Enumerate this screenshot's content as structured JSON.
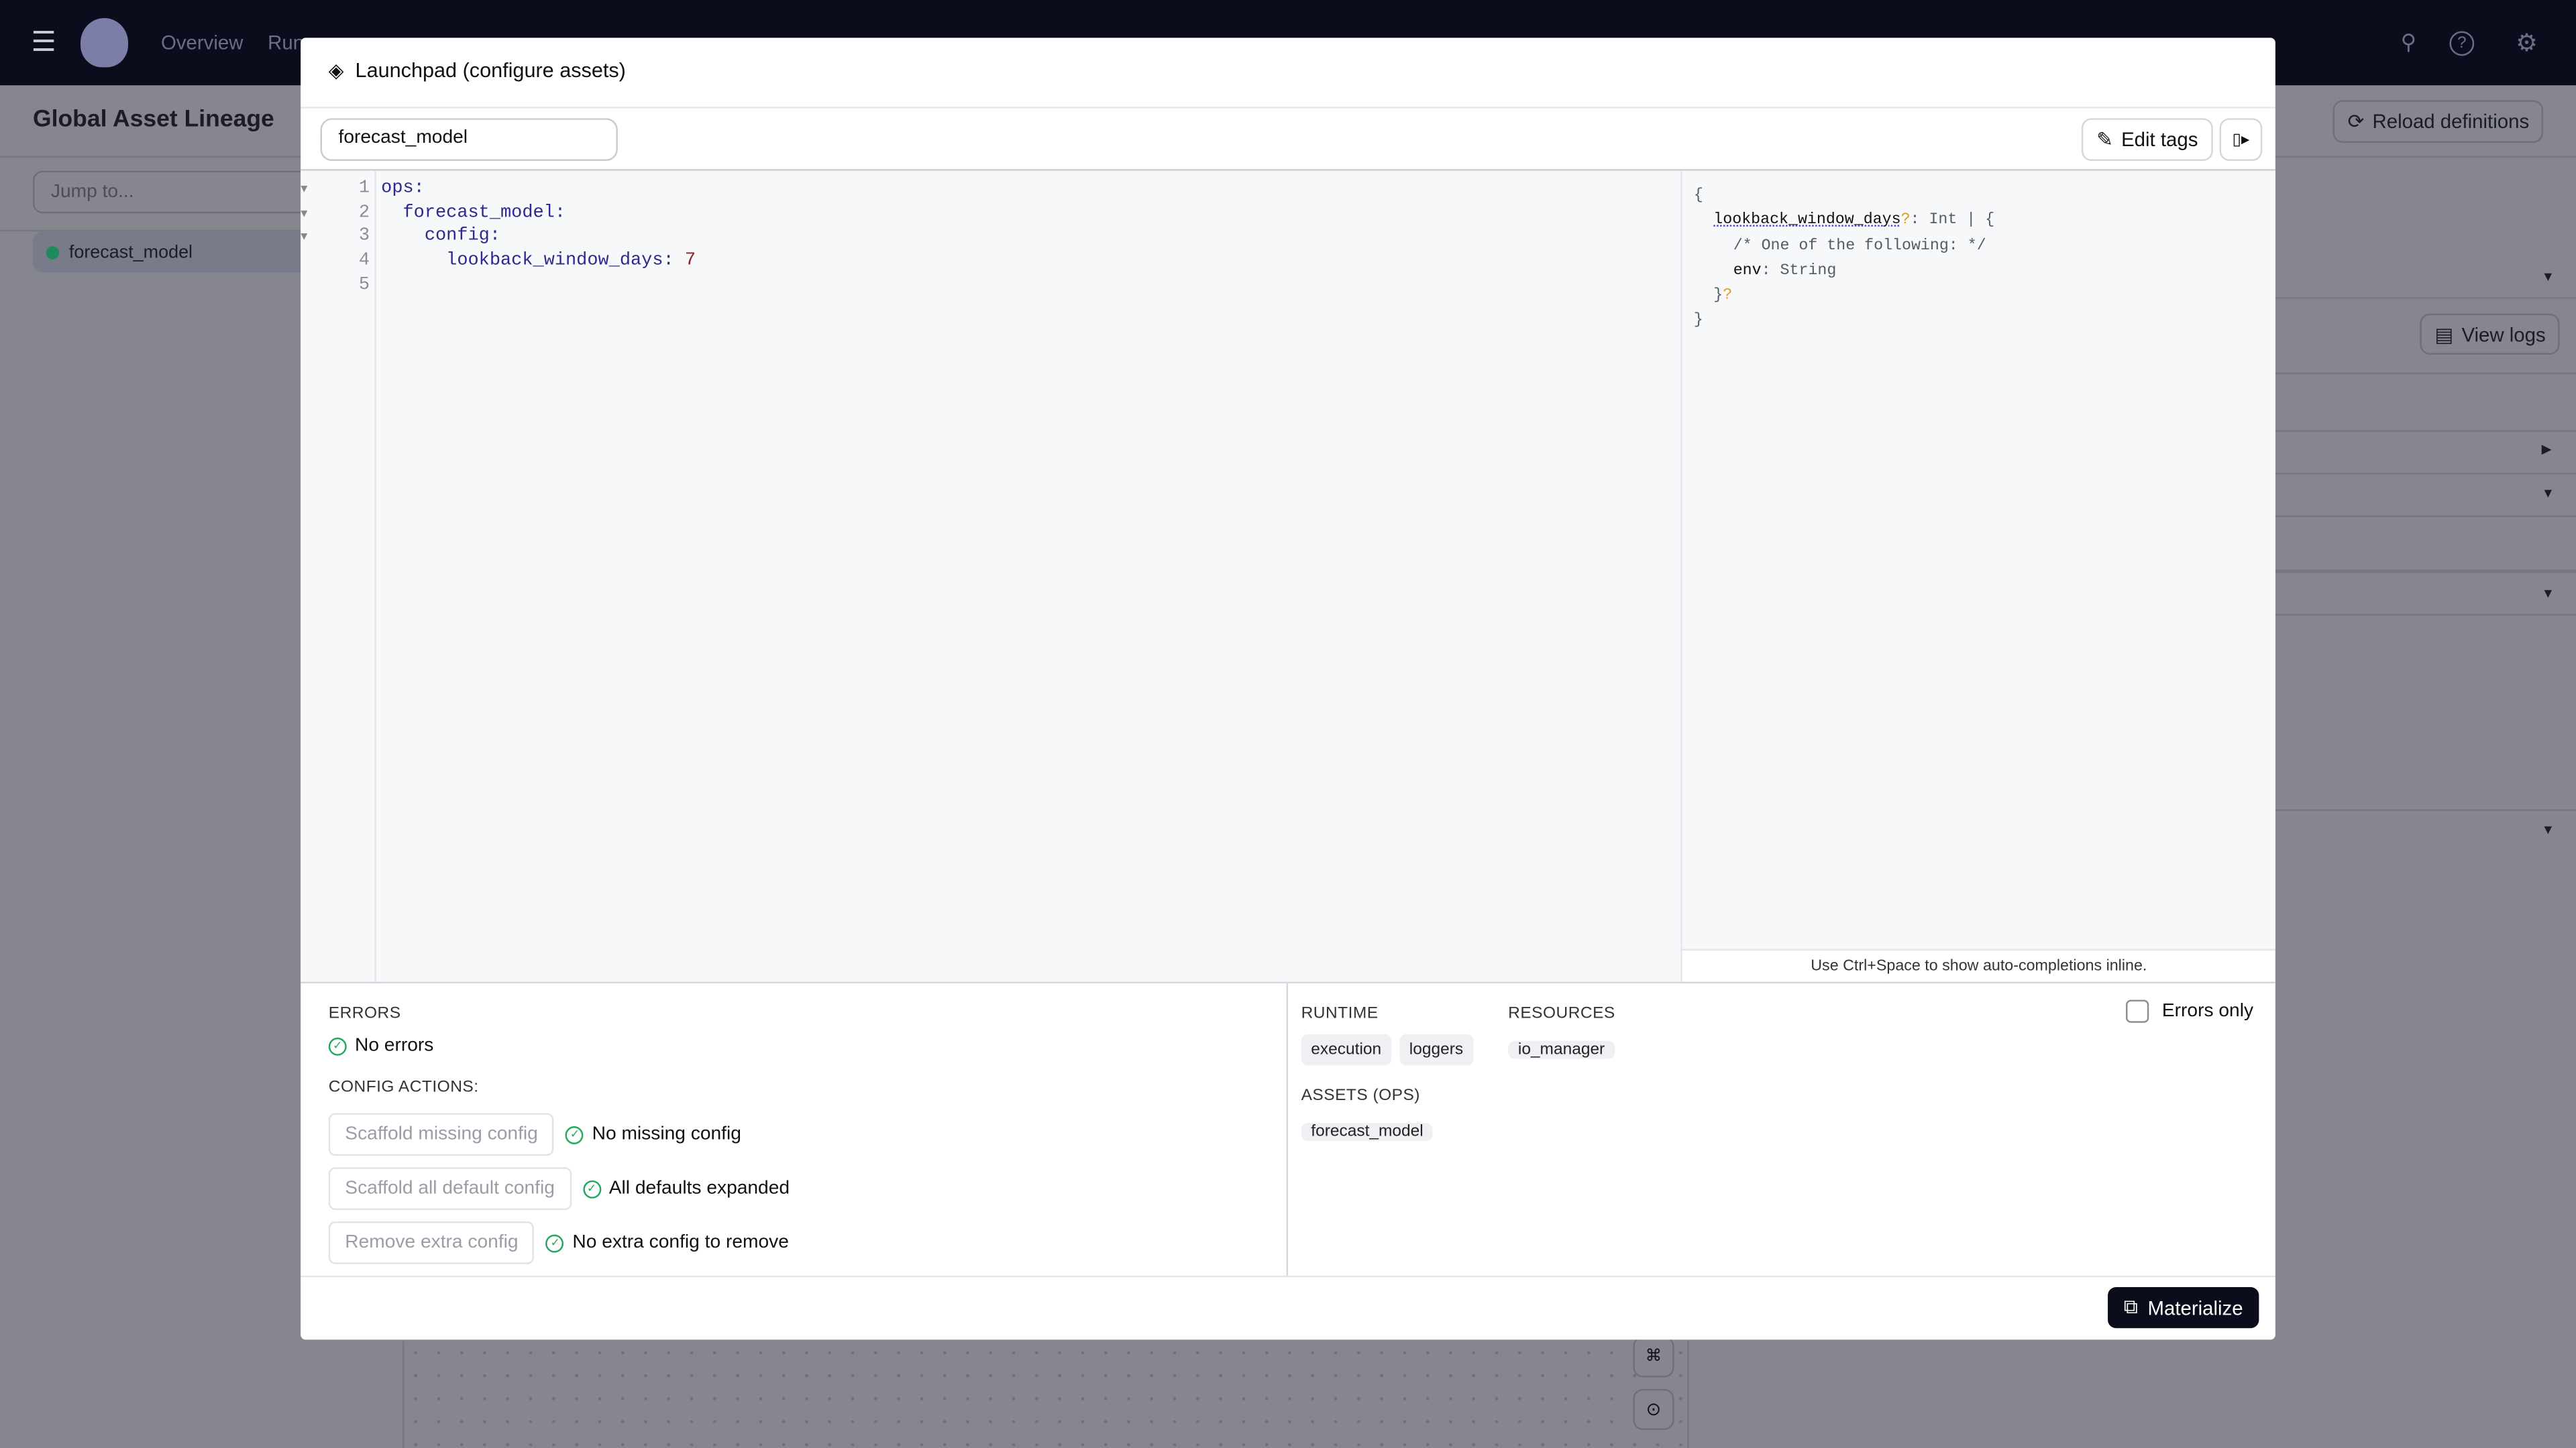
{
  "topbar": {
    "nav": [
      "Overview",
      "Runs"
    ],
    "icons": [
      "menu-icon",
      "logo",
      "search-icon",
      "help-icon",
      "settings-icon"
    ]
  },
  "page": {
    "title": "Global Asset Lineage",
    "reload_label": "Reload definitions",
    "jump_placeholder": "Jump to...",
    "sidebar_items": [
      {
        "label": "forecast_model",
        "status_color": "#1f8a5a"
      }
    ],
    "view_logs_label": "View logs"
  },
  "modal": {
    "title": "Launchpad (configure assets)",
    "tab_input_value": "forecast_model",
    "edit_tags_label": "Edit tags",
    "editor": {
      "line_numbers": [
        "1",
        "2",
        "3",
        "4",
        "5"
      ],
      "lines": [
        {
          "indent": "",
          "key": "ops:",
          "value": ""
        },
        {
          "indent": "  ",
          "key": "forecast_model:",
          "value": ""
        },
        {
          "indent": "    ",
          "key": "config:",
          "value": ""
        },
        {
          "indent": "      ",
          "key": "lookback_window_days:",
          "value": " 7"
        },
        {
          "indent": "",
          "key": "",
          "value": ""
        }
      ]
    },
    "schema": {
      "open": "{",
      "field": "lookback_window_days",
      "optional": "?",
      "type_sep": ": Int | {",
      "comment": "/* One of the following: */",
      "env_key": "env",
      "env_type": ": String",
      "close_inner": "}",
      "close_inner_opt": "?",
      "close": "}"
    },
    "hint": "Use Ctrl+Space to show auto-completions inline.",
    "errors": {
      "heading": "ERRORS",
      "status": "No errors"
    },
    "config_actions": {
      "heading": "CONFIG ACTIONS:",
      "items": [
        {
          "button": "Scaffold missing config",
          "status": "No missing config"
        },
        {
          "button": "Scaffold all default config",
          "status": "All defaults expanded"
        },
        {
          "button": "Remove extra config",
          "status": "No extra config to remove"
        }
      ]
    },
    "runtime": {
      "heading": "RUNTIME",
      "tags": [
        "execution",
        "loggers"
      ]
    },
    "resources": {
      "heading": "RESOURCES",
      "tags": [
        "io_manager"
      ]
    },
    "assets": {
      "heading": "ASSETS (OPS)",
      "tags": [
        "forecast_model"
      ]
    },
    "errors_only_label": "Errors only",
    "errors_only_checked": false,
    "materialize_label": "Materialize"
  },
  "colors": {
    "topbar": "#0b0d1c",
    "accent_green": "#23a85c",
    "primary_button": "#0b0d1c"
  }
}
